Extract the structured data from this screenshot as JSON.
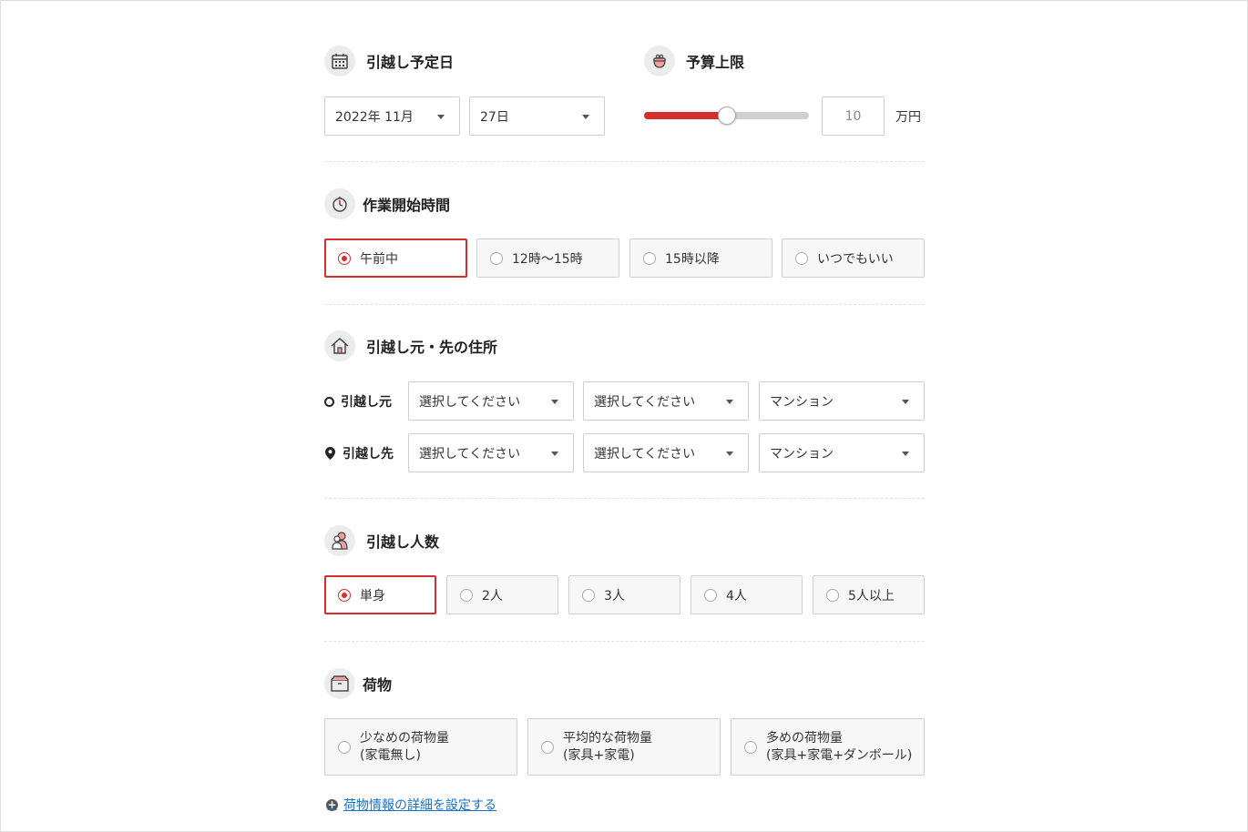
{
  "moving_date": {
    "title": "引越し予定日",
    "icon": "calendar-icon",
    "month_select": "2022年 11月",
    "day_select": "27日"
  },
  "budget": {
    "title": "予算上限",
    "icon": "purse-icon",
    "slider_fraction": 0.5,
    "value": "10",
    "unit": "万円",
    "accent": "#d62d2d"
  },
  "start_time": {
    "title": "作業開始時間",
    "icon": "clock-icon",
    "options": [
      "午前中",
      "12時〜15時",
      "15時以降",
      "いつでもいい"
    ],
    "selected": 0
  },
  "address": {
    "title": "引越し元・先の住所",
    "icon": "house-icon",
    "from_label": "引越し元",
    "to_label": "引越し先",
    "from_selects": [
      "選択してください",
      "選択してください",
      "マンション"
    ],
    "to_selects": [
      "選択してください",
      "選択してください",
      "マンション"
    ]
  },
  "people": {
    "title": "引越し人数",
    "icon": "people-icon",
    "options": [
      "単身",
      "2人",
      "3人",
      "4人",
      "5人以上"
    ],
    "selected": 0
  },
  "luggage": {
    "title": "荷物",
    "icon": "box-icon",
    "options": [
      "少なめの荷物量\n(家電無し)",
      "平均的な荷物量\n(家具+家電)",
      "多めの荷物量\n(家具+家電+ダンボール)"
    ],
    "detail_link": "荷物情報の詳細を設定する"
  }
}
